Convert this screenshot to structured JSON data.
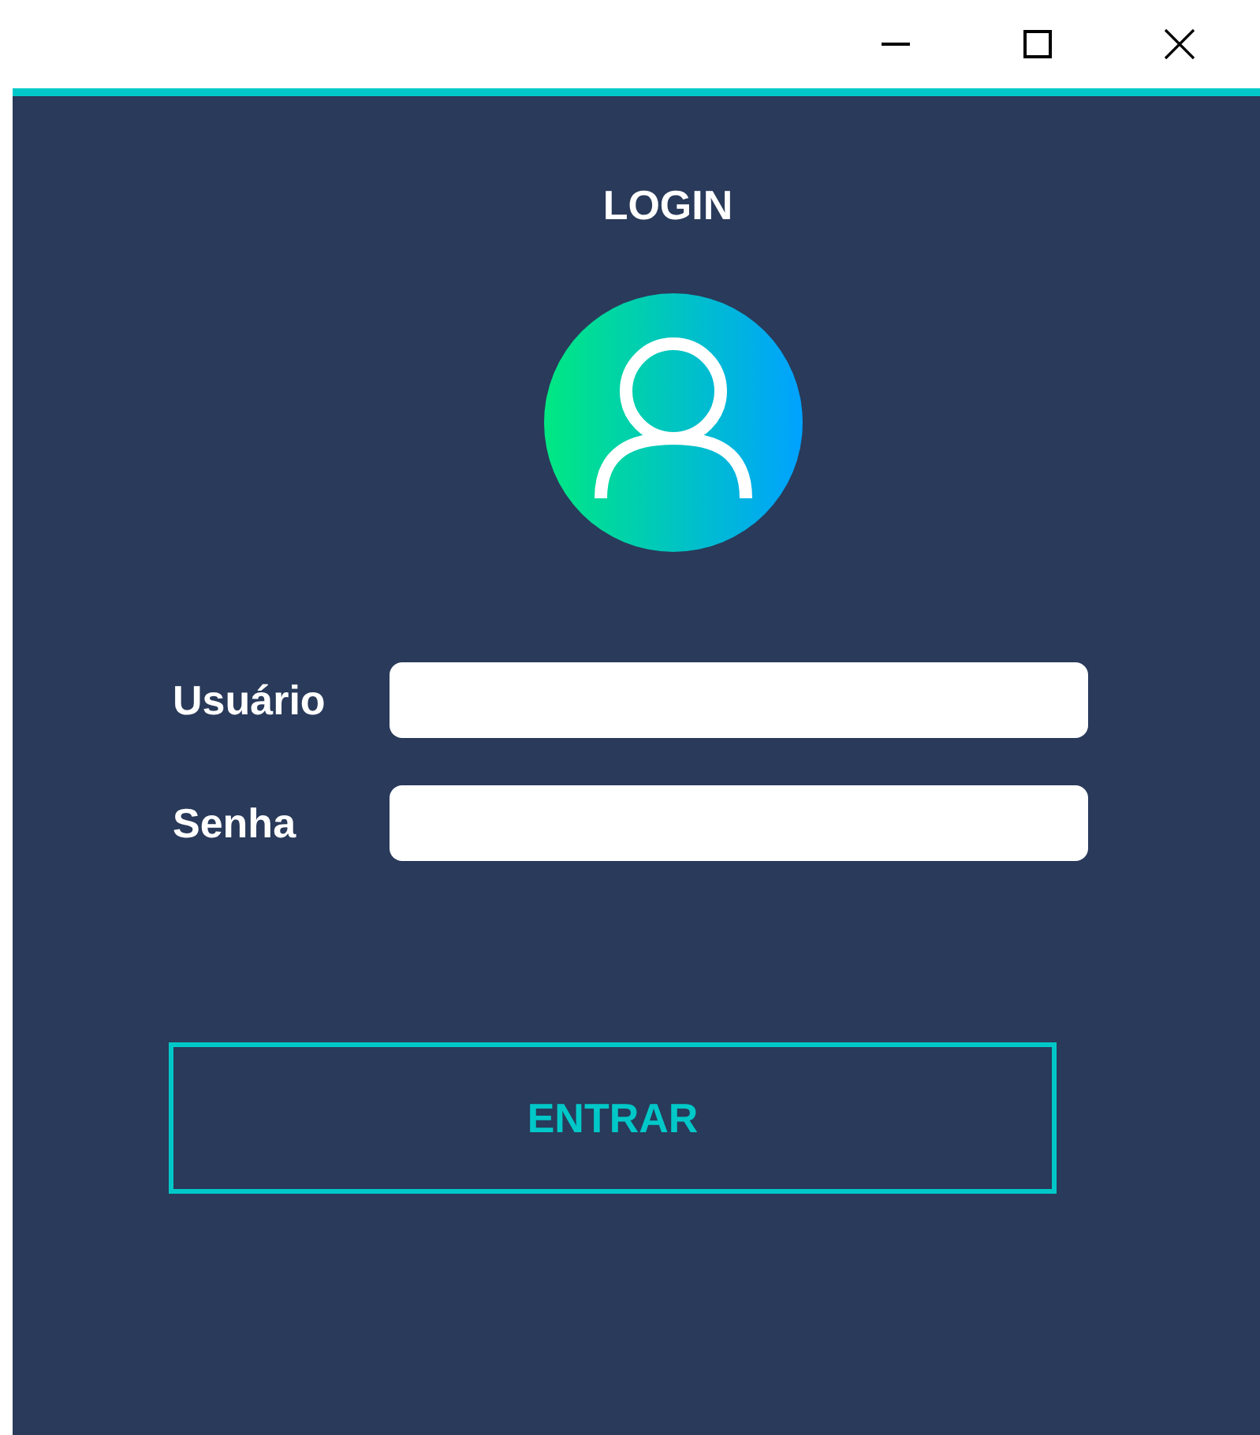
{
  "title": "LOGIN",
  "fields": [
    {
      "label": "Usuário"
    },
    {
      "label": "Senha"
    }
  ],
  "button": "ENTRAR"
}
